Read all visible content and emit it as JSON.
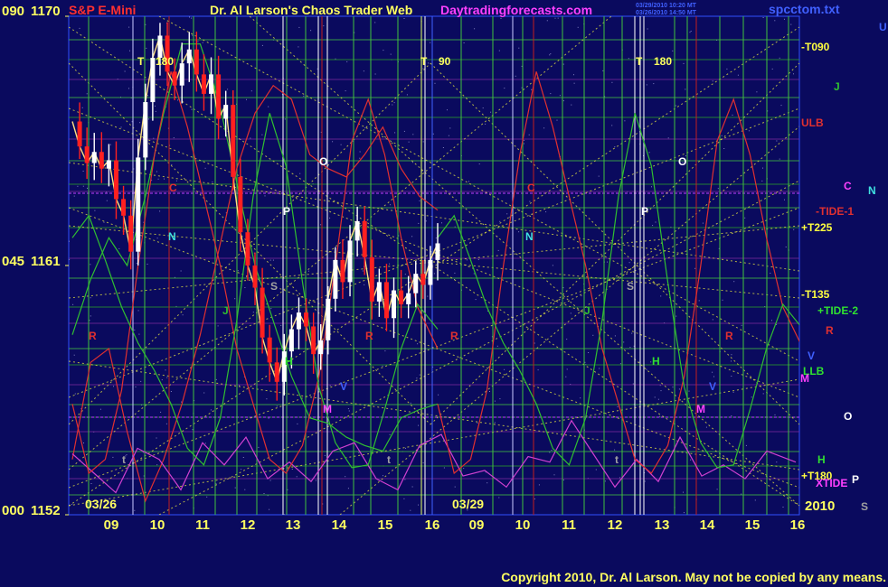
{
  "header": {
    "symbol": "S&P E-Mini",
    "title": "Dr. Al Larson's Chaos Trader Web",
    "site": "Daytradingforecasts.com",
    "stamp1": "03/29/2010 10:20 MT",
    "stamp2": "03/26/2010 14:50 MT",
    "file": "spcctom.txt"
  },
  "footer": {
    "copyright": "Copyright 2010, Dr. Al Larson. May not be copied by any means."
  },
  "y_axis_labels": [
    {
      "angle": "090",
      "price": "1170"
    },
    {
      "angle": "045",
      "price": "1161"
    },
    {
      "angle": "000",
      "price": "1152"
    }
  ],
  "date_labels": [
    "03/26",
    "03/29"
  ],
  "year_label": "2010",
  "colors": {
    "background": "#0a0a5e",
    "price_up": "#ffffff",
    "price_down": "#ff2020",
    "grid_green": "#40c040",
    "grid_red": "#c02020",
    "fan_yellow": "#e8e840",
    "label_yellow": "#ffff40",
    "title_yellow": "#ffff60",
    "site_magenta": "#ff40ff",
    "tide_magenta": "#d040d0",
    "red_line": "#e03030",
    "green_line": "#30c030",
    "cyan": "#40e0e0",
    "blue_label": "#4060ff"
  },
  "chart_data": {
    "type": "line",
    "title": "S&P E-Mini",
    "ylim": [
      1152,
      1170
    ],
    "x_ticks": [
      "09",
      "10",
      "11",
      "12",
      "13",
      "14",
      "15",
      "16",
      "09",
      "10",
      "11",
      "12",
      "13",
      "14",
      "15",
      "16"
    ],
    "y_ticks": [
      1152,
      1161,
      1170
    ],
    "time_markers": [
      {
        "label": "T",
        "value": "180"
      },
      {
        "label": "T",
        "value": "90"
      },
      {
        "label": "T",
        "value": "180"
      }
    ],
    "right_labels": [
      {
        "text": "U",
        "color": "#4060ff"
      },
      {
        "text": "-T090",
        "color": "#ffff40"
      },
      {
        "text": "J",
        "color": "#30c030"
      },
      {
        "text": "ULB",
        "color": "#e03030"
      },
      {
        "text": "C",
        "color": "#ff40ff"
      },
      {
        "text": "N",
        "color": "#40e0e0"
      },
      {
        "text": "-TIDE-1",
        "color": "#e03030"
      },
      {
        "text": "+T225",
        "color": "#ffff40"
      },
      {
        "text": "-T135",
        "color": "#ffff40"
      },
      {
        "text": "+TIDE-2",
        "color": "#30e030"
      },
      {
        "text": "R",
        "color": "#e03030"
      },
      {
        "text": "V",
        "color": "#4060ff"
      },
      {
        "text": "LLB",
        "color": "#30e030"
      },
      {
        "text": "M",
        "color": "#ff40ff"
      },
      {
        "text": "O",
        "color": "#ffffff"
      },
      {
        "text": "H",
        "color": "#30e030"
      },
      {
        "text": "+T180",
        "color": "#ffff40"
      },
      {
        "text": "XTIDE",
        "color": "#ff40ff"
      },
      {
        "text": "P",
        "color": "#ffffff"
      },
      {
        "text": "S",
        "color": "#a0a0a0"
      }
    ],
    "chart_labels": [
      {
        "text": "C",
        "color": "#e03030"
      },
      {
        "text": "N",
        "color": "#40e0e0"
      },
      {
        "text": "P",
        "color": "#ffffff"
      },
      {
        "text": "O",
        "color": "#ffffff"
      },
      {
        "text": "S",
        "color": "#a0a0a0"
      },
      {
        "text": "J",
        "color": "#30c030"
      },
      {
        "text": "R",
        "color": "#e03030"
      },
      {
        "text": "H",
        "color": "#30e030"
      },
      {
        "text": "V",
        "color": "#4060ff"
      },
      {
        "text": "M",
        "color": "#ff40ff"
      },
      {
        "text": "R",
        "color": "#e03030"
      },
      {
        "text": "t",
        "color": "#a0a0a0"
      },
      {
        "text": "t",
        "color": "#a0a0a0"
      },
      {
        "text": "C",
        "color": "#e03030"
      },
      {
        "text": "N",
        "color": "#40e0e0"
      },
      {
        "text": "P",
        "color": "#ffffff"
      },
      {
        "text": "O",
        "color": "#ffffff"
      },
      {
        "text": "S",
        "color": "#a0a0a0"
      },
      {
        "text": "J",
        "color": "#30c030"
      },
      {
        "text": "R",
        "color": "#e03030"
      },
      {
        "text": "H",
        "color": "#30e030"
      },
      {
        "text": "V",
        "color": "#4060ff"
      },
      {
        "text": "M",
        "color": "#ff40ff"
      },
      {
        "text": "R",
        "color": "#e03030"
      },
      {
        "text": "t",
        "color": "#a0a0a0"
      }
    ],
    "price_series": {
      "name": "S&P E-Mini",
      "x": [
        0,
        0.02,
        0.04,
        0.06,
        0.08,
        0.1,
        0.12,
        0.14,
        0.16,
        0.18,
        0.2,
        0.22,
        0.24,
        0.26,
        0.28,
        0.3,
        0.32,
        0.34,
        0.36,
        0.38,
        0.4,
        0.42,
        0.44,
        0.46,
        0.48,
        0.5,
        0.52,
        0.54,
        0.56,
        0.58,
        0.6,
        0.62,
        0.64,
        0.66,
        0.68,
        0.7,
        0.72,
        0.74,
        0.76,
        0.78,
        0.8,
        0.82,
        0.84,
        0.86,
        0.88,
        0.9,
        0.92,
        0.94,
        0.96,
        0.98,
        1.0
      ],
      "y": [
        1166.2,
        1165.3,
        1164.7,
        1165.1,
        1164.5,
        1164.8,
        1163.4,
        1162.8,
        1161.5,
        1164.9,
        1166.9,
        1168.5,
        1169.3,
        1168.0,
        1167.5,
        1168.3,
        1168.8,
        1167.9,
        1167.2,
        1167.9,
        1166.3,
        1166.8,
        1164.2,
        1162.2,
        1161.0,
        1160.2,
        1158.4,
        1157.5,
        1156.8,
        1157.9,
        1158.7,
        1159.3,
        1158.8,
        1157.8,
        1158.3,
        1159.8,
        1161.2,
        1160.4,
        1161.9,
        1162.6,
        1161.3,
        1159.7,
        1160.4,
        1159.1,
        1160.1,
        1159.6,
        1160.0,
        1160.7,
        1160.3,
        1161.2,
        1161.8
      ]
    },
    "series": [
      {
        "x": [
          0.0,
          0.05,
          0.1,
          0.15,
          0.2,
          0.25,
          0.3,
          0.35,
          0.4,
          0.45,
          0.5,
          0.55,
          0.6,
          0.65,
          0.7,
          0.75,
          0.8,
          0.85,
          0.9,
          0.95,
          1.0
        ],
        "y": [
          1158.5,
          1160.5,
          1162,
          1161,
          1163.5,
          1166.5,
          1169,
          1169,
          1167,
          1164,
          1161,
          1159,
          1157,
          1155.5,
          1155.3,
          1154.8,
          1154.5,
          1154.3,
          1155.5,
          1155.8,
          1156
        ]
      },
      {
        "x": [
          0.0,
          0.05,
          0.1,
          0.15,
          0.2,
          0.25,
          0.3,
          0.35,
          0.4,
          0.45,
          0.5,
          0.55,
          0.6,
          0.65,
          0.7,
          0.75,
          0.8,
          0.85,
          0.9,
          0.95,
          1.0
        ],
        "y": [
          1154,
          1157.5,
          1158,
          1155,
          1152.5,
          1154,
          1156,
          1158.5,
          1161.5,
          1164.5,
          1166.5,
          1167.5,
          1167,
          1165,
          1164.5,
          1164.2,
          1165,
          1166,
          1164.5,
          1163.5,
          1163
        ]
      },
      {
        "x": [
          0.0,
          0.03,
          0.06,
          0.09,
          0.12,
          0.15,
          0.18,
          0.21,
          0.24,
          0.27,
          0.3,
          0.33,
          0.36,
          0.39,
          0.42,
          0.45,
          0.48,
          0.51,
          0.54,
          0.57,
          0.6,
          0.63,
          0.66,
          0.69,
          0.72,
          0.75,
          0.78,
          0.81,
          0.84,
          0.87,
          0.9,
          0.93,
          0.96,
          1.0
        ],
        "y": [
          1154.2,
          1153.5,
          1152.8,
          1154.4,
          1154.0,
          1152.9,
          1154.6,
          1153.8,
          1154.8,
          1153.3,
          1153.9,
          1153.2,
          1154.3,
          1154.6,
          1153.3,
          1152.9,
          1154.5,
          1154.9,
          1153.4,
          1153.6,
          1153.0,
          1154.1,
          1153.9,
          1155.4,
          1154.2,
          1153.0,
          1154.0,
          1153.2,
          1154.8,
          1153.4,
          1153.8,
          1153.3,
          1154.3,
          1153.9
        ]
      }
    ],
    "forecast_lines": [
      {
        "x": [
          0.0,
          0.045,
          0.09,
          0.135,
          0.18,
          0.225,
          0.27,
          0.315,
          0.36,
          0.405,
          0.45,
          0.495,
          0.54,
          0.585,
          0.63,
          0.675,
          0.72,
          0.765,
          0.81,
          0.855,
          0.9,
          0.945,
          1.0
        ],
        "y": [
          1156,
          1153.5,
          1154,
          1156.5,
          1161,
          1165,
          1168,
          1166,
          1163.5,
          1161,
          1158,
          1156,
          1154,
          1153.5,
          1154.5,
          1157,
          1161,
          1165.5,
          1167,
          1165,
          1162,
          1159.5,
          1158
        ]
      },
      {
        "x": [
          0.0,
          0.045,
          0.09,
          0.135,
          0.18,
          0.225,
          0.27,
          0.315,
          0.36,
          0.405,
          0.45,
          0.495,
          0.54,
          0.585,
          0.63,
          0.675,
          0.72,
          0.765,
          0.81,
          0.855,
          0.9,
          0.945,
          1.0
        ],
        "y": [
          1162,
          1162.8,
          1161.2,
          1159.5,
          1158.2,
          1157.2,
          1156.0,
          1154.4,
          1153.8,
          1155.5,
          1159,
          1163.5,
          1166.5,
          1164.6,
          1160.4,
          1156.6,
          1154.6,
          1153.7,
          1153.8,
          1155.8,
          1158.0,
          1159.6,
          1158.7
        ]
      }
    ]
  }
}
